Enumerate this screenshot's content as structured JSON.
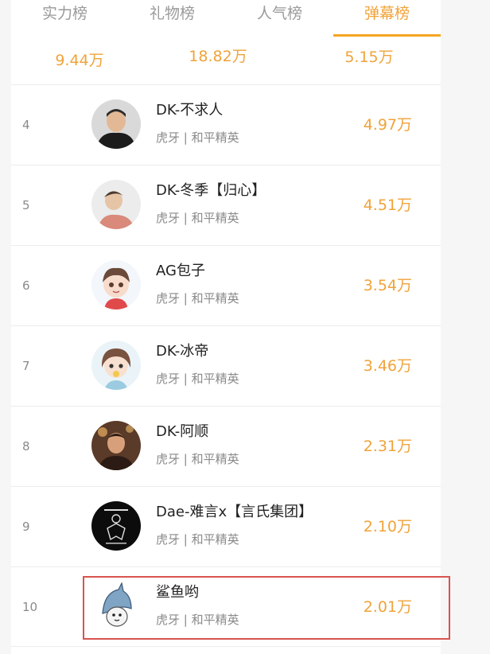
{
  "tabs": [
    "实力榜",
    "礼物榜",
    "人气榜",
    "弹幕榜"
  ],
  "active_tab_index": 3,
  "top3_values": [
    "9.44万",
    "18.82万",
    "5.15万"
  ],
  "accent_color": "#f0a33a",
  "highlight_color": "#d9534f",
  "rows": [
    {
      "rank": "4",
      "name": "DK-不求人",
      "platform": "虎牙 | 和平精英",
      "score": "4.97万",
      "avatar": "man-photo-avatar"
    },
    {
      "rank": "5",
      "name": "DK-冬季【归心】",
      "platform": "虎牙 | 和平精英",
      "score": "4.51万",
      "avatar": "man-photo-avatar"
    },
    {
      "rank": "6",
      "name": "AG包子",
      "platform": "虎牙 | 和平精英",
      "score": "3.54万",
      "avatar": "cartoon-boy-avatar"
    },
    {
      "rank": "7",
      "name": "DK-冰帝",
      "platform": "虎牙 | 和平精英",
      "score": "3.46万",
      "avatar": "cartoon-girl-avatar"
    },
    {
      "rank": "8",
      "name": "DK-阿顺",
      "platform": "虎牙 | 和平精英",
      "score": "2.31万",
      "avatar": "man-photo-avatar"
    },
    {
      "rank": "9",
      "name": "Dae-难言x【言氏集团】",
      "platform": "虎牙 | 和平精英",
      "score": "2.10万",
      "avatar": "black-logo-avatar"
    },
    {
      "rank": "10",
      "name": "鲨鱼哟",
      "platform": "虎牙 | 和平精英",
      "score": "2.01万",
      "avatar": "shark-avatar"
    }
  ]
}
